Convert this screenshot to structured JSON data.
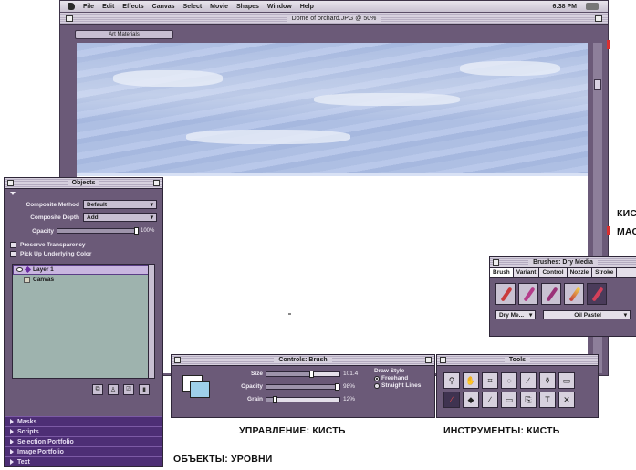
{
  "menubar": {
    "items": [
      "File",
      "Edit",
      "Effects",
      "Canvas",
      "Select",
      "Movie",
      "Shapes",
      "Window",
      "Help"
    ],
    "clock": "6:38 PM"
  },
  "document": {
    "title": "Dome of orchard.JPG @ 50%",
    "view_label": "Art Materials"
  },
  "objects_palette": {
    "title": "Objects",
    "composite_method_label": "Composite Method",
    "composite_method_value": "Default",
    "composite_depth_label": "Composite Depth",
    "composite_depth_value": "Add",
    "opacity_label": "Opacity",
    "opacity_value": "100%",
    "opacity_fraction": 1.0,
    "preserve_transparency_label": "Preserve Transparency",
    "pick_up_underlying_label": "Pick Up Underlying Color",
    "layers": [
      "Layer 1",
      "Canvas"
    ],
    "sections": [
      "Masks",
      "Scripts",
      "Selection Portfolio",
      "Image Portfolio",
      "Text"
    ]
  },
  "controls_palette": {
    "title": "Controls: Brush",
    "sliders": [
      {
        "label": "Size",
        "value": "101.4",
        "fraction": 0.62
      },
      {
        "label": "Opacity",
        "value": "98%",
        "fraction": 0.98
      },
      {
        "label": "Grain",
        "value": "12%",
        "fraction": 0.12
      }
    ],
    "draw_style_label": "Draw Style",
    "freehand_label": "Freehand",
    "straight_lines_label": "Straight Lines"
  },
  "tools_palette": {
    "title": "Tools",
    "tools": [
      "magnifier-icon",
      "grabber-icon",
      "crop-icon",
      "lasso-icon",
      "brush-icon",
      "dropper-icon",
      "rectangle-icon",
      "brush-active-icon",
      "paint-bucket-icon",
      "pen-icon",
      "rect-select-icon",
      "stamp-icon",
      "text-icon",
      "cross-icon"
    ],
    "tool_glyphs": [
      "⚲",
      "✋",
      "⌗",
      "◌",
      "∕",
      "⚱",
      "▭",
      "∕",
      "◆",
      "∕",
      "▭",
      "⎘",
      "T",
      "✕"
    ]
  },
  "brushes_palette": {
    "title": "Brushes: Dry Media",
    "tabs": [
      "Brush",
      "Variant",
      "Control",
      "Nozzle",
      "Stroke"
    ],
    "category_value": "Dry Me...",
    "variant_value": "Oil Pastel"
  },
  "captions": {
    "controls": "УПРАВЛЕНИЕ: КИСТЬ",
    "tools": "ИНСТРУМЕНТЫ: КИСТЬ",
    "objects": "ОБЪЕКТЫ: УРОВНИ",
    "right_top": "КИС",
    "right_bottom": "МАС"
  },
  "colors": {
    "palette_bg": "#6b5a78",
    "sky": "#aebfe3",
    "accent_red": "#d93030",
    "layer_select": "#c9b6e0"
  }
}
